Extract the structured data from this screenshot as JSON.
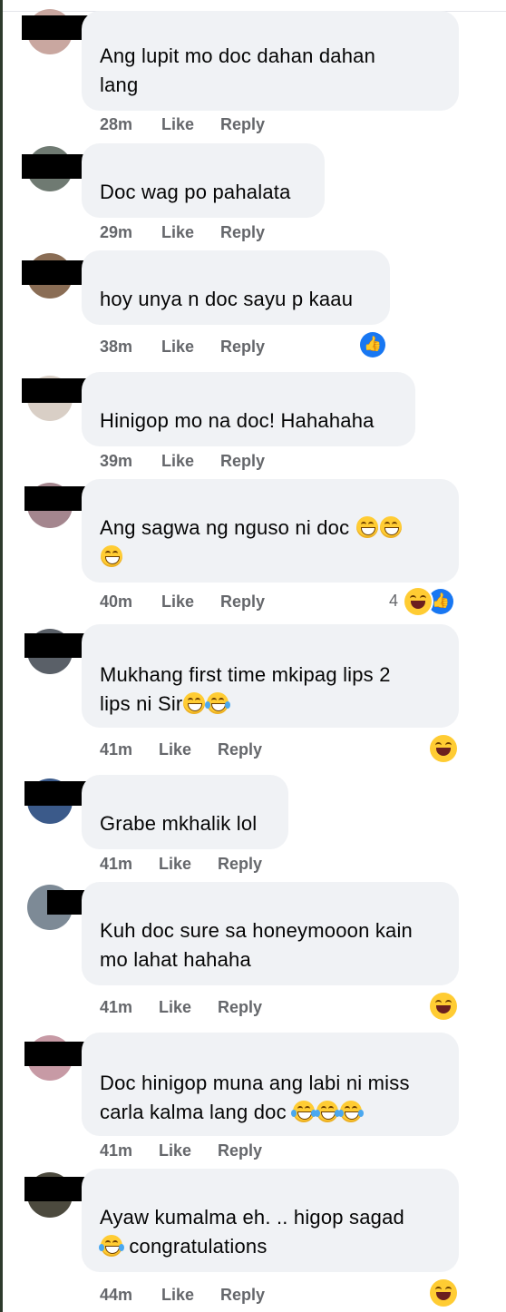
{
  "colors": {
    "bubble_bg": "#f0f2f5",
    "meta_text": "#65676b",
    "like_blue": "#1877f2",
    "haha_yellow": "#ffcc33"
  },
  "comments": [
    {
      "lines": [
        "Ang lupit mo doc dahan dahan",
        "lang"
      ],
      "time": "28m",
      "like_label": "Like",
      "reply_label": "Reply",
      "reactions": []
    },
    {
      "lines": [
        "Doc wag po pahalata"
      ],
      "time": "29m",
      "like_label": "Like",
      "reply_label": "Reply",
      "reactions": []
    },
    {
      "lines": [
        "hoy unya n doc sayu p kaau"
      ],
      "time": "38m",
      "like_label": "Like",
      "reply_label": "Reply",
      "reactions": [
        "like-icon"
      ]
    },
    {
      "lines": [
        "Hinigop mo na doc! Hahahaha"
      ],
      "time": "39m",
      "like_label": "Like",
      "reply_label": "Reply",
      "reactions": []
    },
    {
      "lines": [
        "Ang sagwa ng nguso ni doc",
        ""
      ],
      "time": "40m",
      "like_label": "Like",
      "reply_label": "Reply",
      "reaction_count": "4",
      "reactions": [
        "haha-icon",
        "like-icon"
      ]
    },
    {
      "lines": [
        "Mukhang first time mkipag lips 2",
        "lips ni Sir"
      ],
      "time": "41m",
      "like_label": "Like",
      "reply_label": "Reply",
      "reactions": [
        "haha-icon"
      ]
    },
    {
      "lines": [
        "Grabe mkhalik lol"
      ],
      "time": "41m",
      "like_label": "Like",
      "reply_label": "Reply",
      "reactions": []
    },
    {
      "lines": [
        "Kuh doc sure sa honeymooon kain",
        "mo lahat hahaha"
      ],
      "time": "41m",
      "like_label": "Like",
      "reply_label": "Reply",
      "reactions": [
        "haha-icon"
      ]
    },
    {
      "lines": [
        "Doc hinigop muna ang labi ni miss",
        "carla kalma lang doc"
      ],
      "time": "41m",
      "like_label": "Like",
      "reply_label": "Reply",
      "reactions": []
    },
    {
      "lines": [
        "Ayaw kumalma eh. .. higop sagad",
        "congratulations"
      ],
      "time": "44m",
      "like_label": "Like",
      "reply_label": "Reply",
      "reactions": [
        "haha-icon"
      ]
    }
  ]
}
